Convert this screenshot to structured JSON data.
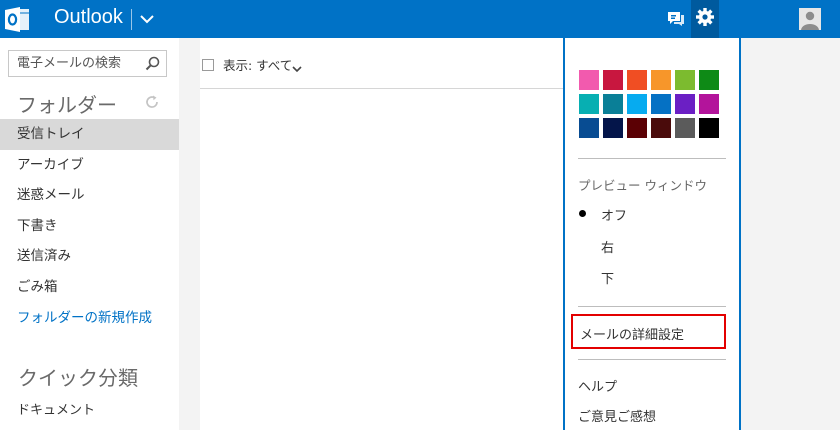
{
  "header": {
    "app_name": "Outlook",
    "logo_letter": "O",
    "chat_icon": "chat-bubble-icon",
    "settings_icon": "gear-icon",
    "avatar_icon": "user-avatar-icon",
    "colors": {
      "bar": "#0072c6",
      "active": "#005a9e"
    }
  },
  "sidebar": {
    "search_placeholder": "電子メールの検索",
    "folders_heading": "フォルダー",
    "folders": [
      {
        "label": "受信トレイ",
        "selected": true
      },
      {
        "label": "アーカイブ"
      },
      {
        "label": "迷惑メール"
      },
      {
        "label": "下書き"
      },
      {
        "label": "送信済み"
      },
      {
        "label": "ごみ箱"
      }
    ],
    "new_folder_label": "フォルダーの新規作成",
    "quick_views_heading": "クイック分類",
    "quick_views": [
      "ドキュメント"
    ]
  },
  "message_list": {
    "filter_label": "表示: すべて"
  },
  "settings_menu": {
    "theme_colors": [
      "#f25aae",
      "#c8173f",
      "#f04e23",
      "#f7962a",
      "#7cbb2f",
      "#0e8a16",
      "#07afb2",
      "#0a7f97",
      "#06abf0",
      "#0571c4",
      "#6b1fc4",
      "#b3149b",
      "#084c92",
      "#04154a",
      "#5b0004",
      "#4a0b0b",
      "#5b5b5b",
      "#000000"
    ],
    "preview_heading": "プレビュー ウィンドウ",
    "preview_options": [
      {
        "label": "オフ",
        "selected": true
      },
      {
        "label": "右"
      },
      {
        "label": "下"
      }
    ],
    "advanced_settings_label": "メールの詳細設定",
    "help_label": "ヘルプ",
    "feedback_label": "ご意見ご感想",
    "highlight_color": "#e30000"
  }
}
